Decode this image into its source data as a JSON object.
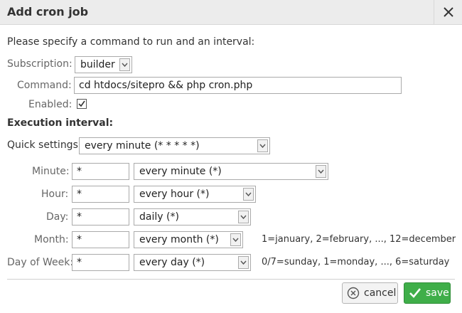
{
  "dialog": {
    "title": "Add cron job"
  },
  "intro": "Please specify a command to run and an interval:",
  "subscription": {
    "label": "Subscription:",
    "value": "builder"
  },
  "command": {
    "label": "Command:",
    "value": "cd htdocs/sitepro && php cron.php"
  },
  "enabled": {
    "label": "Enabled:",
    "checked": true
  },
  "execution": {
    "heading": "Execution interval:"
  },
  "quick": {
    "label": "Quick settings:",
    "value": "every minute (* * * * *)"
  },
  "rows": {
    "minute": {
      "label": "Minute:",
      "value": "*",
      "select": "every minute (*)"
    },
    "hour": {
      "label": "Hour:",
      "value": "*",
      "select": "every hour (*)"
    },
    "day": {
      "label": "Day:",
      "value": "*",
      "select": "daily (*)"
    },
    "month": {
      "label": "Month:",
      "value": "*",
      "select": "every month (*)",
      "hint": "1=january, 2=february, ..., 12=december"
    },
    "dow": {
      "label": "Day of Week:",
      "value": "*",
      "select": "every day (*)",
      "hint": "0/7=sunday, 1=monday, ..., 6=saturday"
    }
  },
  "buttons": {
    "cancel": "cancel",
    "save": "save"
  },
  "colors": {
    "save_bg": "#3fae49",
    "titlebar_bg": "#ececec"
  },
  "icons": {
    "close": "close-icon",
    "cancel": "cancel-circle-icon",
    "save": "check-icon",
    "checkbox": "checkbox-checked-icon",
    "dropdown": "chevron-down-icon"
  }
}
